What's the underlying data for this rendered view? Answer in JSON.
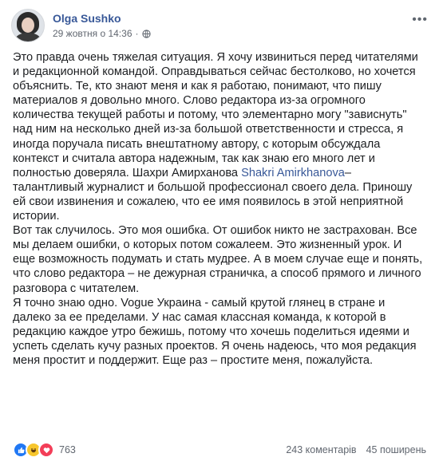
{
  "post": {
    "author": "Olga Sushko",
    "timestamp": "29 жовтня о 14:36",
    "separator": "·",
    "more_label": "•••",
    "text_part1": "Это правда очень тяжелая ситуация. Я хочу извиниться перед читателями и редакционной командой. Оправдываться сейчас бестолково, но хочется объяснить. Те, кто знают меня и как я работаю, понимают, что пишу материалов я довольно много. Слово редактора из-за огромного количества текущей работы и потому, что элементарно могу \"зависнуть\" над ним на несколько дней из-за большой ответственности и стресса, я иногда поручала писать внештатному автору, с которым обсуждала контекст и считала автора надежным, так как знаю его много лет и полностью доверяла. Шахри Амирханова",
    "mention": "Shakri Amirkhanova",
    "text_part2": "– талантливый журналист и большой профессионал своего дела. Приношу ей свои извинения и сожалею, что ее имя появилось в этой неприятной истории.",
    "paragraph2": "Вот так случилось. Это моя ошибка. От ошибок никто не застрахован. Все мы делаем ошибки, о которых потом сожалеем. Это жизненный урок. И еще возможность подумать и стать мудрее. А в моем случае еще и понять, что слово редактора – не дежурная страничка, а способ прямого и личного разговора с читателем.",
    "paragraph3": "Я точно знаю одно. Vogue Украина - самый крутой глянец в стране и далеко за ее пределами. У нас самая классная команда, к которой в редакцию каждое утро бежишь, потому что хочешь поделиться идеями и успеть сделать кучу разных проектов. Я очень надеюсь, что моя редакция меня простит и поддержит. Еще раз – простите меня, пожалуйста."
  },
  "footer": {
    "reaction_icons": [
      "like-icon",
      "haha-icon",
      "love-icon"
    ],
    "reaction_count": "763",
    "comments": "243 коментарів",
    "shares": "45 поширень"
  },
  "colors": {
    "author_link": "#385898",
    "like": "#2078f4",
    "haha": "#f7c62c",
    "love": "#f33e58",
    "meta_text": "#616770"
  }
}
